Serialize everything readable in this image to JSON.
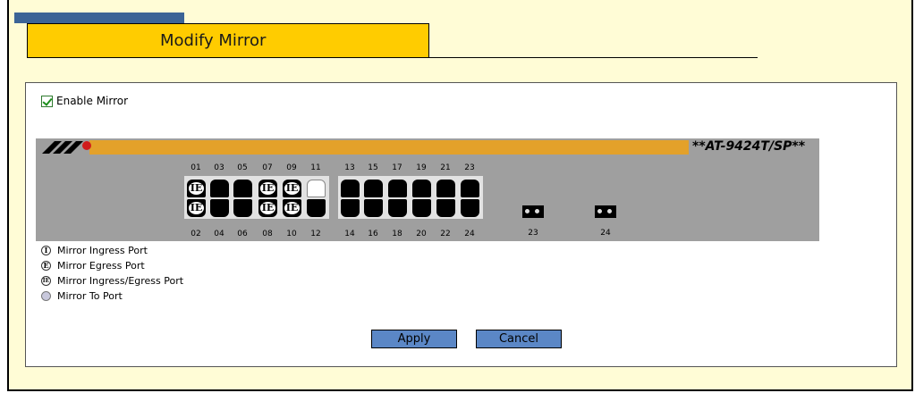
{
  "header": {
    "title": "Modify Mirror"
  },
  "enable": {
    "label": "Enable Mirror",
    "checked": true
  },
  "device": {
    "model": "**AT-9424T/SP**"
  },
  "ports": {
    "top_labels": [
      "01",
      "03",
      "05",
      "07",
      "09",
      "11",
      "13",
      "15",
      "17",
      "19",
      "21",
      "23"
    ],
    "bottom_labels": [
      "02",
      "04",
      "06",
      "08",
      "10",
      "12",
      "14",
      "16",
      "18",
      "20",
      "22",
      "24"
    ],
    "fiber_labels": [
      "23",
      "24"
    ],
    "top_states": [
      "IE",
      "black",
      "black",
      "IE",
      "IE",
      "white",
      "black",
      "black",
      "black",
      "black",
      "black",
      "black"
    ],
    "bottom_states": [
      "IE",
      "black",
      "black",
      "IE",
      "IE",
      "black",
      "black",
      "black",
      "black",
      "black",
      "black",
      "black"
    ]
  },
  "legend": {
    "ingress": "Mirror Ingress Port",
    "egress": "Mirror Egress Port",
    "both": "Mirror Ingress/Egress Port",
    "to": "Mirror To Port"
  },
  "buttons": {
    "apply": "Apply",
    "cancel": "Cancel"
  },
  "colors": {
    "accent": "#ffcc00",
    "banner": "#e3a12a",
    "button": "#5b87c6",
    "background": "#fffcd6"
  }
}
